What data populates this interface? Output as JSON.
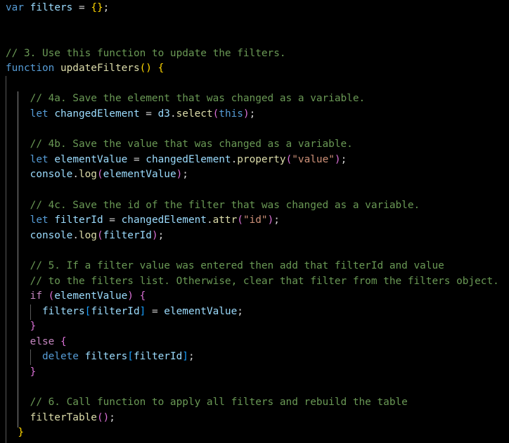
{
  "code": {
    "lines": [
      [
        {
          "t": "var",
          "c": "kw"
        },
        {
          "t": " ",
          "c": "pl"
        },
        {
          "t": "filters",
          "c": "var"
        },
        {
          "t": " = ",
          "c": "pl"
        },
        {
          "t": "{}",
          "c": "br1"
        },
        {
          "t": ";",
          "c": "pl"
        }
      ],
      [],
      [],
      [
        {
          "t": "// 3. Use this function to update the filters.",
          "c": "cm"
        }
      ],
      [
        {
          "t": "function",
          "c": "kw"
        },
        {
          "t": " ",
          "c": "pl"
        },
        {
          "t": "updateFilters",
          "c": "fn"
        },
        {
          "t": "()",
          "c": "br1"
        },
        {
          "t": " ",
          "c": "pl"
        },
        {
          "t": "{",
          "c": "br1"
        }
      ],
      [],
      [
        {
          "t": "    ",
          "c": "pl"
        },
        {
          "t": "// 4a. Save the element that was changed as a variable.",
          "c": "cm"
        }
      ],
      [
        {
          "t": "    ",
          "c": "pl"
        },
        {
          "t": "let",
          "c": "kw"
        },
        {
          "t": " ",
          "c": "pl"
        },
        {
          "t": "changedElement",
          "c": "var"
        },
        {
          "t": " = ",
          "c": "pl"
        },
        {
          "t": "d3",
          "c": "var"
        },
        {
          "t": ".",
          "c": "pl"
        },
        {
          "t": "select",
          "c": "fn"
        },
        {
          "t": "(",
          "c": "br2"
        },
        {
          "t": "this",
          "c": "kw"
        },
        {
          "t": ")",
          "c": "br2"
        },
        {
          "t": ";",
          "c": "pl"
        }
      ],
      [],
      [
        {
          "t": "    ",
          "c": "pl"
        },
        {
          "t": "// 4b. Save the value that was changed as a variable.",
          "c": "cm"
        }
      ],
      [
        {
          "t": "    ",
          "c": "pl"
        },
        {
          "t": "let",
          "c": "kw"
        },
        {
          "t": " ",
          "c": "pl"
        },
        {
          "t": "elementValue",
          "c": "var"
        },
        {
          "t": " = ",
          "c": "pl"
        },
        {
          "t": "changedElement",
          "c": "var"
        },
        {
          "t": ".",
          "c": "pl"
        },
        {
          "t": "property",
          "c": "fn"
        },
        {
          "t": "(",
          "c": "br2"
        },
        {
          "t": "\"value\"",
          "c": "str"
        },
        {
          "t": ")",
          "c": "br2"
        },
        {
          "t": ";",
          "c": "pl"
        }
      ],
      [
        {
          "t": "    ",
          "c": "pl"
        },
        {
          "t": "console",
          "c": "var"
        },
        {
          "t": ".",
          "c": "pl"
        },
        {
          "t": "log",
          "c": "fn"
        },
        {
          "t": "(",
          "c": "br2"
        },
        {
          "t": "elementValue",
          "c": "var"
        },
        {
          "t": ")",
          "c": "br2"
        },
        {
          "t": ";",
          "c": "pl"
        }
      ],
      [],
      [
        {
          "t": "    ",
          "c": "pl"
        },
        {
          "t": "// 4c. Save the id of the filter that was changed as a variable.",
          "c": "cm"
        }
      ],
      [
        {
          "t": "    ",
          "c": "pl"
        },
        {
          "t": "let",
          "c": "kw"
        },
        {
          "t": " ",
          "c": "pl"
        },
        {
          "t": "filterId",
          "c": "var"
        },
        {
          "t": " = ",
          "c": "pl"
        },
        {
          "t": "changedElement",
          "c": "var"
        },
        {
          "t": ".",
          "c": "pl"
        },
        {
          "t": "attr",
          "c": "fn"
        },
        {
          "t": "(",
          "c": "br2"
        },
        {
          "t": "\"id\"",
          "c": "str"
        },
        {
          "t": ")",
          "c": "br2"
        },
        {
          "t": ";",
          "c": "pl"
        }
      ],
      [
        {
          "t": "    ",
          "c": "pl"
        },
        {
          "t": "console",
          "c": "var"
        },
        {
          "t": ".",
          "c": "pl"
        },
        {
          "t": "log",
          "c": "fn"
        },
        {
          "t": "(",
          "c": "br2"
        },
        {
          "t": "filterId",
          "c": "var"
        },
        {
          "t": ")",
          "c": "br2"
        },
        {
          "t": ";",
          "c": "pl"
        }
      ],
      [],
      [
        {
          "t": "    ",
          "c": "pl"
        },
        {
          "t": "// 5. If a filter value was entered then add that filterId and value",
          "c": "cm"
        }
      ],
      [
        {
          "t": "    ",
          "c": "pl"
        },
        {
          "t": "// to the filters list. Otherwise, clear that filter from the filters object.",
          "c": "cm"
        }
      ],
      [
        {
          "t": "    ",
          "c": "pl"
        },
        {
          "t": "if",
          "c": "ctl"
        },
        {
          "t": " ",
          "c": "pl"
        },
        {
          "t": "(",
          "c": "br2"
        },
        {
          "t": "elementValue",
          "c": "var"
        },
        {
          "t": ")",
          "c": "br2"
        },
        {
          "t": " ",
          "c": "pl"
        },
        {
          "t": "{",
          "c": "br2"
        }
      ],
      [
        {
          "t": "      ",
          "c": "pl"
        },
        {
          "t": "filters",
          "c": "var"
        },
        {
          "t": "[",
          "c": "br3"
        },
        {
          "t": "filterId",
          "c": "var"
        },
        {
          "t": "]",
          "c": "br3"
        },
        {
          "t": " = ",
          "c": "pl"
        },
        {
          "t": "elementValue",
          "c": "var"
        },
        {
          "t": ";",
          "c": "pl"
        }
      ],
      [
        {
          "t": "    ",
          "c": "pl"
        },
        {
          "t": "}",
          "c": "br2"
        }
      ],
      [
        {
          "t": "    ",
          "c": "pl"
        },
        {
          "t": "else",
          "c": "ctl"
        },
        {
          "t": " ",
          "c": "pl"
        },
        {
          "t": "{",
          "c": "br2"
        }
      ],
      [
        {
          "t": "      ",
          "c": "pl"
        },
        {
          "t": "delete",
          "c": "kw"
        },
        {
          "t": " ",
          "c": "pl"
        },
        {
          "t": "filters",
          "c": "var"
        },
        {
          "t": "[",
          "c": "br3"
        },
        {
          "t": "filterId",
          "c": "var"
        },
        {
          "t": "]",
          "c": "br3"
        },
        {
          "t": ";",
          "c": "pl"
        }
      ],
      [
        {
          "t": "    ",
          "c": "pl"
        },
        {
          "t": "}",
          "c": "br2"
        }
      ],
      [],
      [
        {
          "t": "    ",
          "c": "pl"
        },
        {
          "t": "// 6. Call function to apply all filters and rebuild the table",
          "c": "cm"
        }
      ],
      [
        {
          "t": "    ",
          "c": "pl"
        },
        {
          "t": "filterTable",
          "c": "fn"
        },
        {
          "t": "()",
          "c": "br2"
        },
        {
          "t": ";",
          "c": "pl"
        }
      ],
      [
        {
          "t": "  ",
          "c": "pl"
        },
        {
          "t": "}",
          "c": "br1"
        }
      ]
    ]
  },
  "colors": {
    "background": "#000000",
    "keyword": "#569cd6",
    "control": "#c586c0",
    "variable": "#9cdcfe",
    "function": "#dcdcaa",
    "string": "#ce9178",
    "comment": "#6a9955",
    "bracket_level1": "#ffd700",
    "bracket_level2": "#da70d6",
    "bracket_level3": "#179fff"
  }
}
